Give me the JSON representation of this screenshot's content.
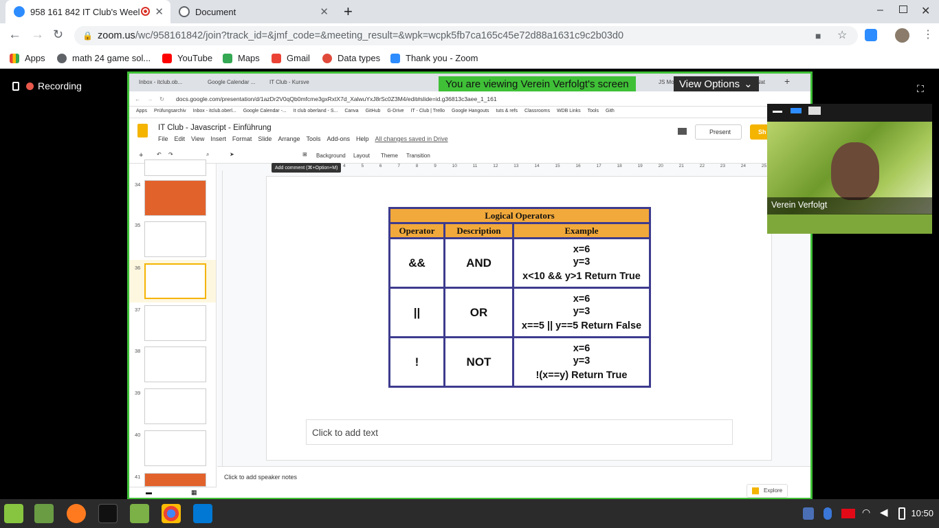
{
  "browser": {
    "tabs": [
      {
        "title": "958 161 842 IT Club's Weel",
        "active": true
      },
      {
        "title": "Document",
        "active": false
      }
    ],
    "url_host": "zoom.us",
    "url_rest": "/wc/958161842/join?track_id=&jmf_code=&meeting_result=&wpk=wcpk5fb7ca165c45e72d88a1631c9c2b03d0",
    "bookmarks": [
      "Apps",
      "math 24 game sol...",
      "YouTube",
      "Maps",
      "Gmail",
      "Data types",
      "Thank you - Zoom"
    ]
  },
  "zoom": {
    "recording_label": "Recording",
    "viewing_banner": "You are viewing Verein Verfolgt's screen",
    "view_options_label": "View Options",
    "participant_name": "Verein Verfolgt"
  },
  "inner_browser": {
    "tabs": [
      "Inbox - itclub.ob...",
      "Google Calendar ...",
      "IT Club - Kursve",
      "JS Module 101 -",
      "CNCF Cloud Nat"
    ],
    "url": "docs.google.com/presentation/d/1azDr2V0qQb0mfcme3gxRxtX7d_XalwuYxJ8rSc0Z3M4/edit#slide=id.g36813c3aee_1_161",
    "bookmarks": [
      "Apps",
      "Prüfungsarchiv",
      "Inbox - itclub.oberl...",
      "Google Calendar -...",
      "It club oberland - S...",
      "Canva",
      "GitHub",
      "G-Drive",
      "IT - Club | Trello",
      "Google Hangouts",
      "tuts & refs",
      "Classrooms",
      "WDB Links",
      "Tools",
      "Gith"
    ]
  },
  "slides": {
    "doc_title": "IT Club - Javascript - Einführung",
    "menu": [
      "File",
      "Edit",
      "View",
      "Insert",
      "Format",
      "Slide",
      "Arrange",
      "Tools",
      "Add-ons",
      "Help"
    ],
    "save_status": "All changes saved in Drive",
    "present_label": "Present",
    "share_label": "Sh",
    "toolbar_items": [
      "Background",
      "Layout",
      "Theme",
      "Transition"
    ],
    "tooltip": "Add comment (⌘+Option+M)",
    "slide_numbers": [
      "34",
      "35",
      "36",
      "37",
      "38",
      "39",
      "40",
      "41"
    ],
    "active_slide": "36",
    "ruler_numbers": [
      "4",
      "5",
      "6",
      "7",
      "8",
      "9",
      "10",
      "11",
      "12",
      "13",
      "14",
      "15",
      "16",
      "17",
      "18",
      "19",
      "20",
      "21",
      "22",
      "23",
      "24",
      "25"
    ],
    "add_text_placeholder": "Click to add text",
    "speaker_notes_placeholder": "Click to add speaker notes",
    "explore_label": "Explore"
  },
  "logical_table": {
    "title": "Logical Operators",
    "headers": [
      "Operator",
      "Description",
      "Example"
    ],
    "rows": [
      {
        "op": "&&",
        "desc": "AND",
        "ex1": "x=6",
        "ex2": "y=3",
        "ex3": "x<10 && y>1 Return True"
      },
      {
        "op": "||",
        "desc": "OR",
        "ex1": "x=6",
        "ex2": "y=3",
        "ex3": "x==5 || y==5 Return False"
      },
      {
        "op": "!",
        "desc": "NOT",
        "ex1": "x=6",
        "ex2": "y=3",
        "ex3": "!(x==y) Return True"
      }
    ]
  },
  "taskbar": {
    "clock": "10:50"
  }
}
